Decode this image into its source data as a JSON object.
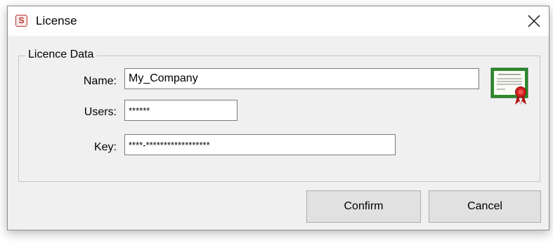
{
  "window": {
    "title": "License",
    "app_icon": "app-logo-icon",
    "close_icon": "close-icon"
  },
  "group": {
    "legend": "Licence Data",
    "icon": "certificate-icon"
  },
  "fields": {
    "name_label": "Name:",
    "name_value": "My_Company",
    "users_label": "Users:",
    "users_value": "******",
    "key_label": "Key:",
    "key_value": "****-******************"
  },
  "buttons": {
    "confirm": "Confirm",
    "cancel": "Cancel"
  },
  "colors": {
    "window_bg": "#f0f0f0",
    "button_bg": "#e1e1e1",
    "cert_green": "#2e8b2e",
    "seal_red": "#d11f1f"
  }
}
